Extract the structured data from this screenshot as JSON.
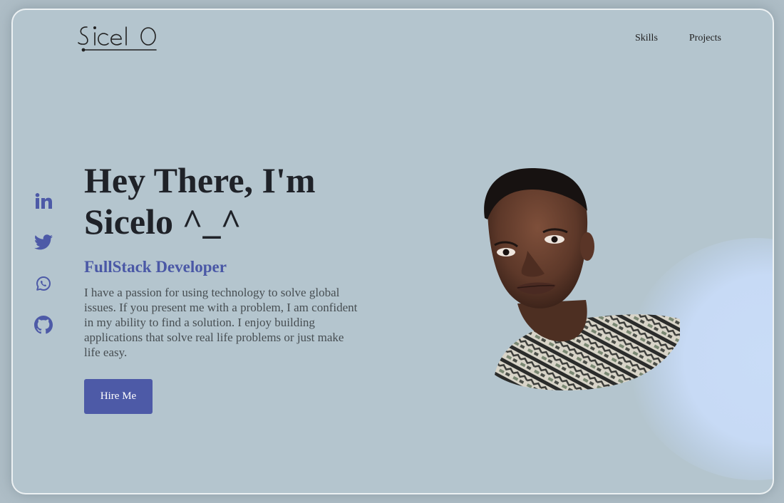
{
  "logo": {
    "text": "Sicelo"
  },
  "nav": {
    "skills": "Skills",
    "projects": "Projects"
  },
  "socials": [
    "linkedin-icon",
    "twitter-icon",
    "whatsapp-icon",
    "github-icon"
  ],
  "hero": {
    "title_line1": "Hey There, I'm",
    "title_line2": "Sicelo ^_^",
    "role": "FullStack Developer",
    "description": "I have a passion for using technology to solve global issues. If you present me with a problem, I am confident in my ability to find a solution. I enjoy building applications that solve real life problems or just make life easy.",
    "cta": "Hire Me"
  },
  "colors": {
    "accent": "#4d5aa7",
    "role_text": "#4a58a6",
    "background": "#b4c5ce",
    "glow": "#c9dcf7",
    "social_icons": "#4d5aa7"
  }
}
